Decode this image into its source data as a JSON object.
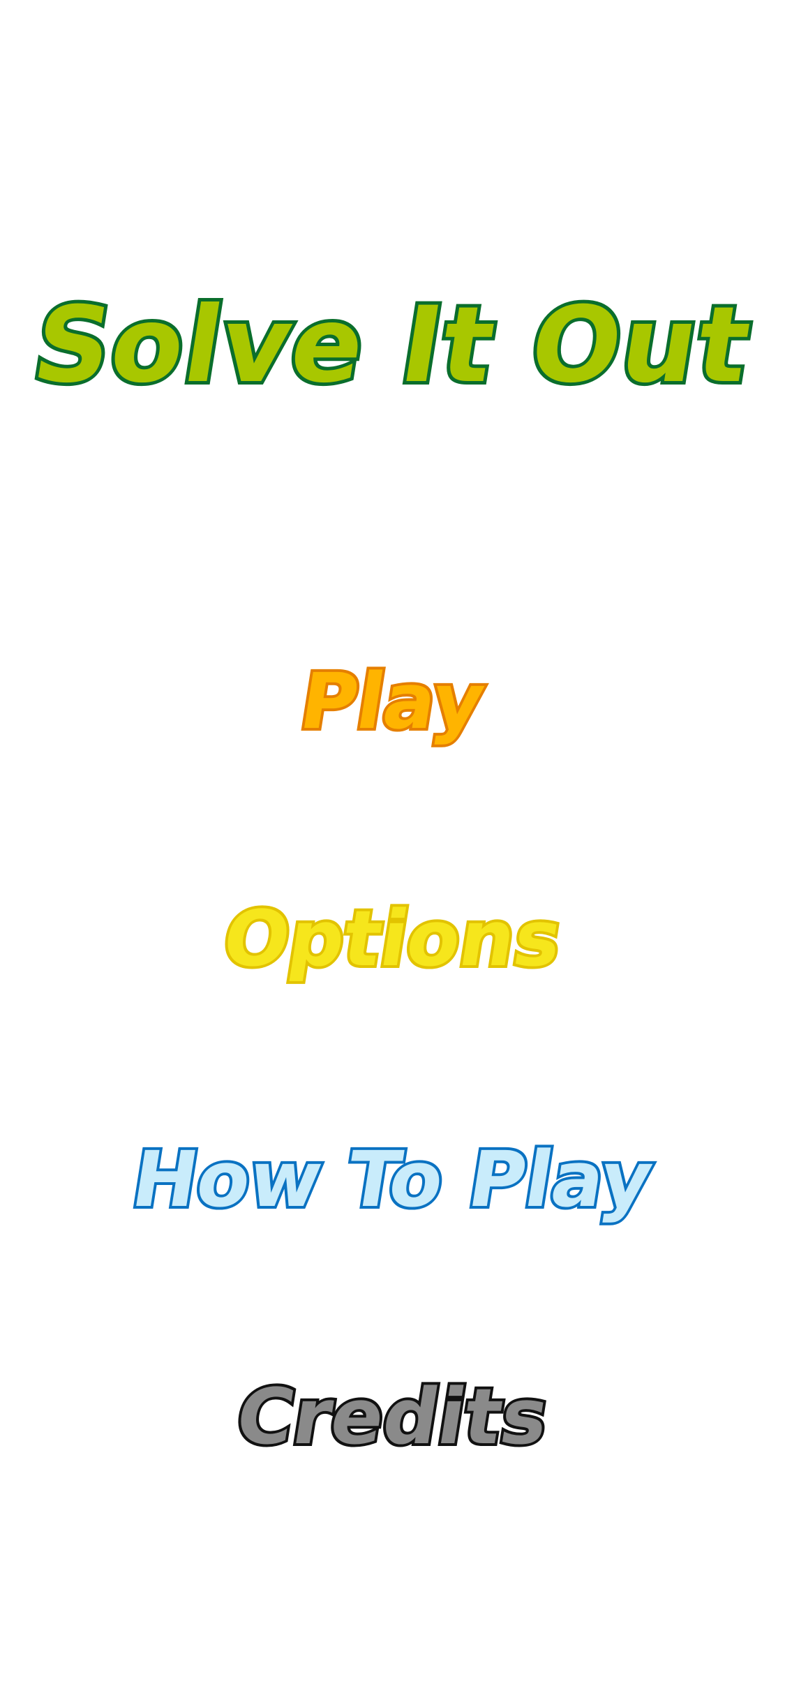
{
  "title": "Solve It Out",
  "menu": {
    "play_label": "Play",
    "options_label": "Options",
    "how_to_play_label": "How To Play",
    "credits_label": "Credits"
  },
  "colors": {
    "background": "#ffffff",
    "title_fill": "#a8c700",
    "title_outline": "#0a6e2c",
    "play_fill": "#ffb400",
    "play_outline": "#e57f00",
    "options_fill": "#f6e61c",
    "options_outline": "#e2c300",
    "how_to_play_fill": "#c9ecfb",
    "how_to_play_outline": "#0a72c2",
    "credits_fill": "#8a8a8a",
    "credits_outline": "#111111"
  }
}
